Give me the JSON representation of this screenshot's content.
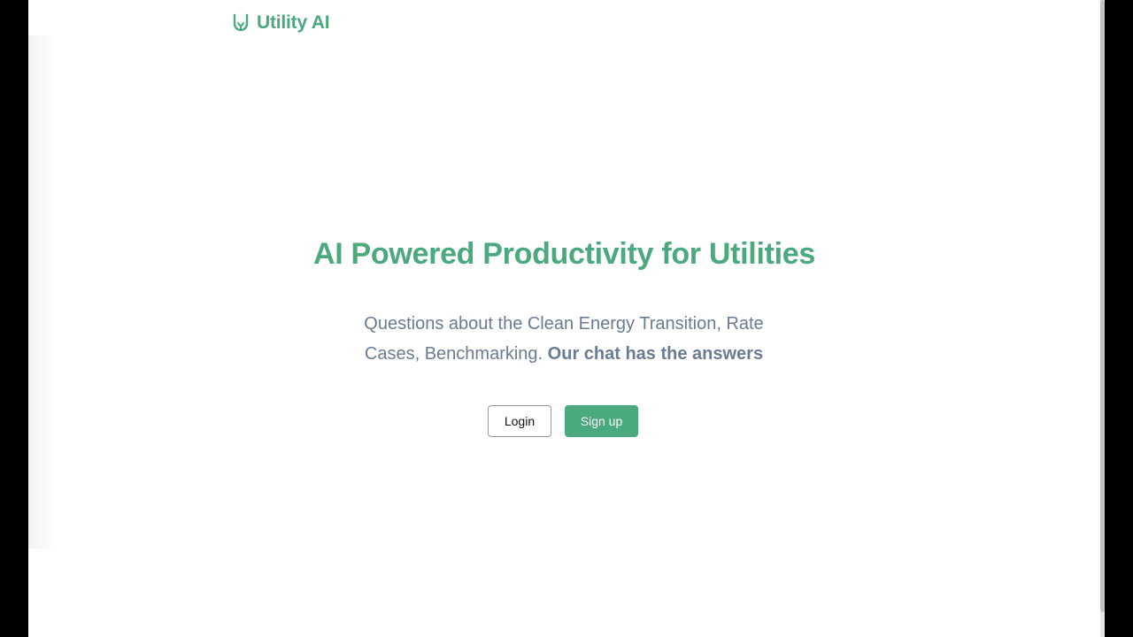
{
  "header": {
    "brand_name": "Utility AI",
    "brand_icon": "u-shield-logo-icon"
  },
  "hero": {
    "title": "AI Powered Productivity for Utilities",
    "subtitle_plain": "Questions about the Clean Energy Transition, Rate Cases, Benchmarking.",
    "subtitle_bold": "Our chat has the answers"
  },
  "actions": {
    "login_label": "Login",
    "signup_label": "Sign up"
  },
  "colors": {
    "brand_green": "#4aa97d",
    "subtitle_gray": "#6b7c92",
    "frame_black": "#000000"
  }
}
